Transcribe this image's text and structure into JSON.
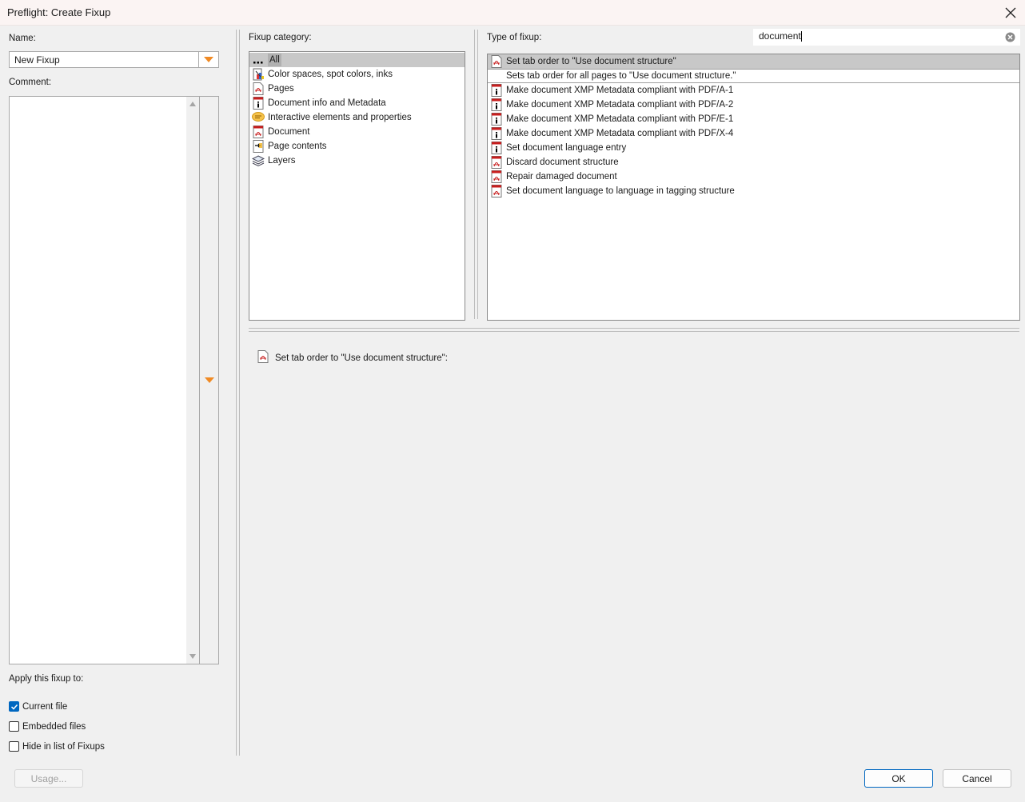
{
  "window": {
    "title": "Preflight: Create Fixup"
  },
  "left": {
    "name_label": "Name:",
    "name_value": "New Fixup",
    "comment_label": "Comment:",
    "apply_label": "Apply this fixup to:",
    "checkboxes": [
      {
        "label": "Current file",
        "checked": true
      },
      {
        "label": "Embedded files",
        "checked": false
      },
      {
        "label": "Hide in list of Fixups",
        "checked": false
      }
    ],
    "usage_button": "Usage..."
  },
  "category": {
    "label": "Fixup category:",
    "items": [
      {
        "label": "All",
        "icon": "dots-icon",
        "selected": true
      },
      {
        "label": "Color spaces, spot colors, inks",
        "icon": "color-spaces-icon"
      },
      {
        "label": "Pages",
        "icon": "pdf-page-icon"
      },
      {
        "label": "Document info and Metadata",
        "icon": "info-icon"
      },
      {
        "label": "Interactive elements and properties",
        "icon": "comment-bubble-icon"
      },
      {
        "label": "Document",
        "icon": "pdf-document-icon"
      },
      {
        "label": "Page contents",
        "icon": "page-contents-icon"
      },
      {
        "label": "Layers",
        "icon": "layers-icon"
      }
    ]
  },
  "fixup": {
    "label": "Type of fixup:",
    "search_value": "document",
    "items": [
      {
        "label": "Set tab order to \"Use document structure\"",
        "icon": "pdf-icon",
        "selected": true
      },
      {
        "label": "Sets tab order for all pages to \"Use document structure.\"",
        "icon": "",
        "description": true
      },
      {
        "label": "Make document XMP Metadata compliant with PDF/A-1",
        "icon": "info-icon"
      },
      {
        "label": "Make document XMP Metadata compliant with PDF/A-2",
        "icon": "info-icon"
      },
      {
        "label": "Make document XMP Metadata compliant with PDF/E-1",
        "icon": "info-icon"
      },
      {
        "label": "Make document XMP Metadata compliant with PDF/X-4",
        "icon": "info-icon"
      },
      {
        "label": "Set document language entry",
        "icon": "info-icon"
      },
      {
        "label": "Discard document structure",
        "icon": "pdf-icon"
      },
      {
        "label": "Repair damaged document",
        "icon": "pdf-icon"
      },
      {
        "label": "Set document language to language in tagging structure",
        "icon": "pdf-icon"
      }
    ]
  },
  "detail": {
    "title": "Set tab order to \"Use document structure\":"
  },
  "buttons": {
    "ok": "OK",
    "cancel": "Cancel"
  },
  "colors": {
    "accent": "#0067c0",
    "orange": "#f08a24",
    "pdf_red": "#c81e1e"
  }
}
